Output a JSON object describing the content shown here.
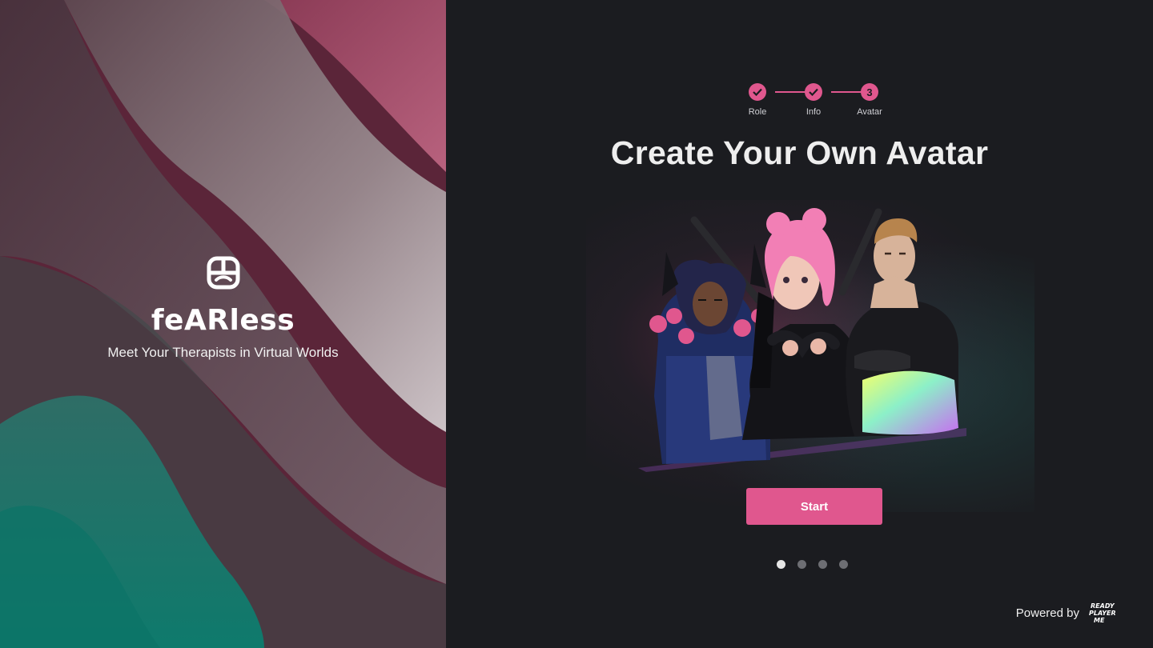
{
  "brand": {
    "name": "feARless",
    "tagline": "Meet Your Therapists in Virtual Worlds"
  },
  "stepper": {
    "steps": [
      {
        "label": "Role",
        "state": "done"
      },
      {
        "label": "Info",
        "state": "done"
      },
      {
        "label": "Avatar",
        "state": "current",
        "number": "3"
      }
    ]
  },
  "main": {
    "title": "Create Your Own Avatar",
    "start_label": "Start"
  },
  "carousel": {
    "count": 4,
    "active_index": 0
  },
  "footer": {
    "powered_by": "Powered by",
    "partner_logo_text": "READY PLAYER ME"
  },
  "colors": {
    "accent": "#e0578e",
    "background": "#1b1c20",
    "dot_active": "#e6e6e6",
    "dot_inactive": "#6d6e73"
  }
}
